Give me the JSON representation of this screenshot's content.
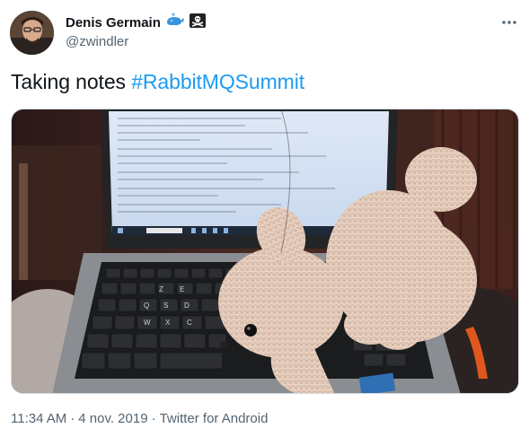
{
  "user": {
    "display_name": "Denis Germain",
    "handle": "@zwindler",
    "badges": [
      "whale-icon",
      "pirate-flag-icon"
    ]
  },
  "tweet": {
    "text_prefix": "Taking notes ",
    "hashtag": "#RabbitMQSummit"
  },
  "media": {
    "icon": "photo-laptop-crochet-rabbit"
  },
  "footer": {
    "time": "11:34 AM",
    "separator1": "·",
    "date": "4 nov. 2019",
    "separator2": "·",
    "source": "Twitter for Android"
  },
  "colors": {
    "link": "#1d9bf0",
    "secondary_text": "#536471",
    "primary_text": "#0f1419"
  }
}
